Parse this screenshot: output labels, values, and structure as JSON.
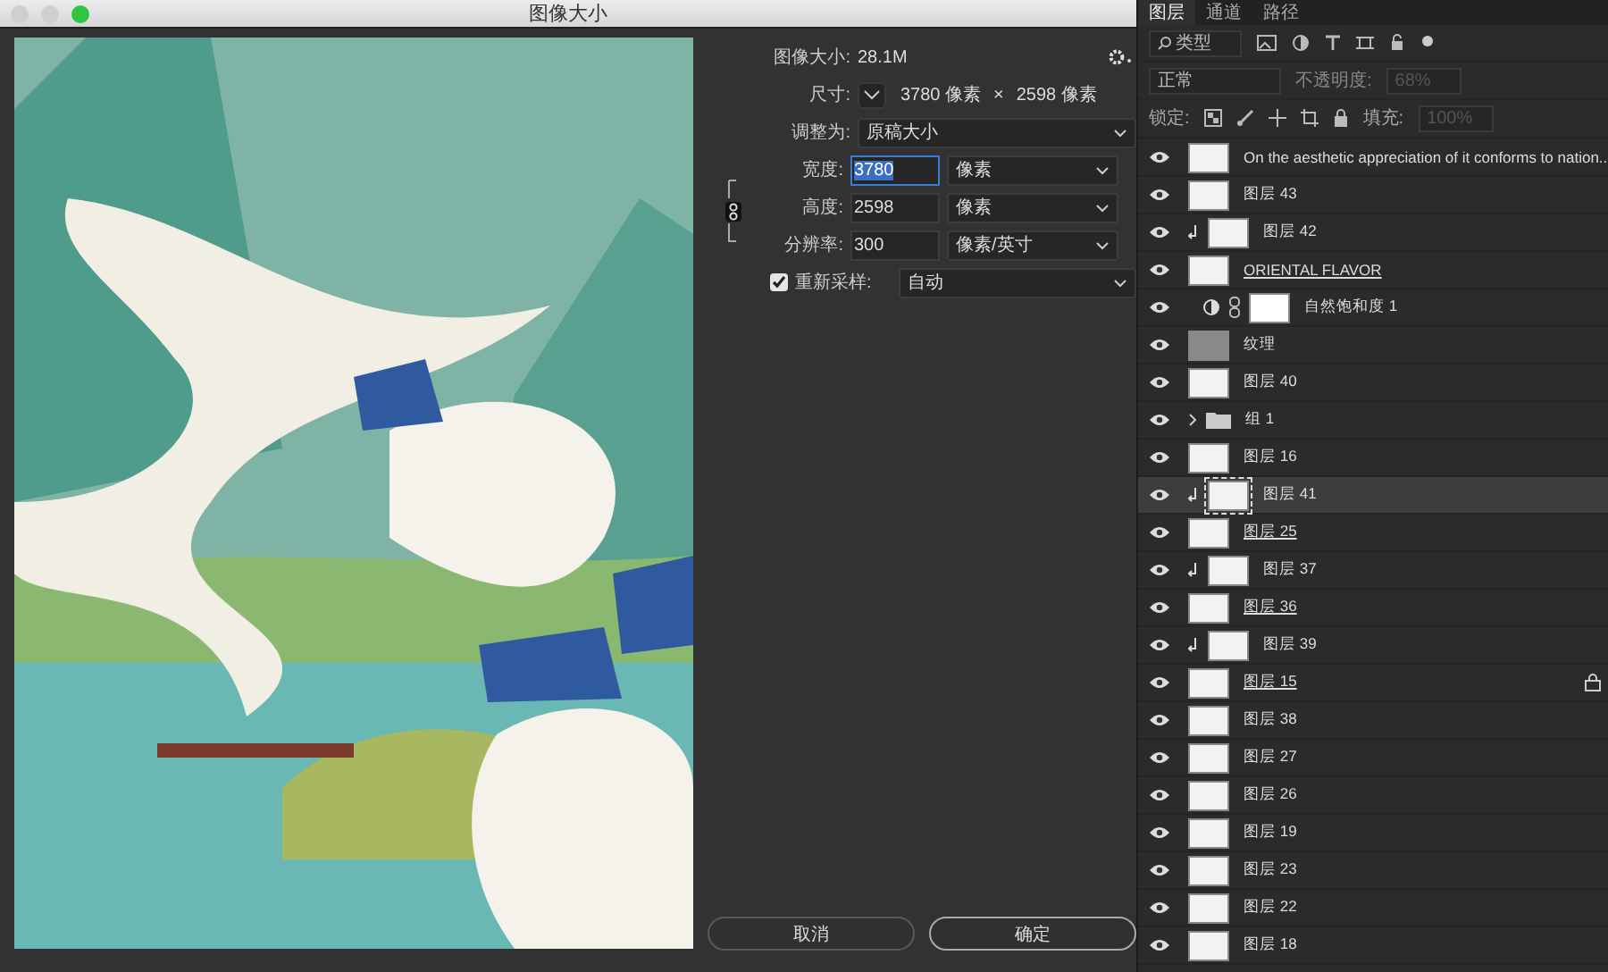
{
  "window": {
    "title": "图像大小"
  },
  "dialog": {
    "image_size": {
      "label": "图像大小:",
      "value": "28.1M"
    },
    "dimensions": {
      "label": "尺寸:",
      "width": "3780 像素",
      "times": "×",
      "height": "2598 像素"
    },
    "fit_to": {
      "label": "调整为:",
      "value": "原稿大小"
    },
    "fields": [
      {
        "label": "宽度:",
        "value": "3780",
        "unit": "像素",
        "selected": true
      },
      {
        "label": "高度:",
        "value": "2598",
        "unit": "像素",
        "selected": false
      },
      {
        "label": "分辨率:",
        "value": "300",
        "unit": "像素/英寸",
        "selected": false
      }
    ],
    "resample": {
      "label": "重新采样:",
      "checked": true,
      "value": "自动"
    },
    "buttons": [
      {
        "label": "取消",
        "primary": false
      },
      {
        "label": "确定",
        "primary": true
      }
    ]
  },
  "layers_panel": {
    "tabs": [
      {
        "label": "图层",
        "selected": true
      },
      {
        "label": "通道",
        "selected": false
      },
      {
        "label": "路径",
        "selected": false
      }
    ],
    "filter": {
      "value": "类型"
    },
    "blend_mode": "正常",
    "opacity": {
      "label": "不透明度:",
      "value": "68%",
      "disabled": true
    },
    "lock_label": "锁定:",
    "fill": {
      "label": "填充:",
      "value": "100%",
      "disabled": true
    },
    "layers": [
      {
        "name": "On the aesthetic appreciation of it conforms to nation...",
        "kind": "layer",
        "clipped": false,
        "underlined": false,
        "locked": false,
        "selected": false
      },
      {
        "name": "图层 43",
        "kind": "layer",
        "clipped": false,
        "underlined": false,
        "locked": false,
        "selected": false
      },
      {
        "name": "图层 42",
        "kind": "layer",
        "clipped": true,
        "underlined": false,
        "locked": false,
        "selected": false
      },
      {
        "name": "ORIENTAL FLAVOR",
        "kind": "layer",
        "clipped": false,
        "underlined": true,
        "locked": false,
        "selected": false
      },
      {
        "name": "自然饱和度 1",
        "kind": "adjustment",
        "clipped": false,
        "underlined": false,
        "locked": false,
        "selected": false
      },
      {
        "name": "纹理",
        "kind": "texture",
        "clipped": false,
        "underlined": false,
        "locked": false,
        "selected": false
      },
      {
        "name": "图层 40",
        "kind": "layer",
        "clipped": false,
        "underlined": false,
        "locked": false,
        "selected": false
      },
      {
        "name": "组 1",
        "kind": "group",
        "clipped": false,
        "underlined": false,
        "locked": false,
        "selected": false
      },
      {
        "name": "图层 16",
        "kind": "layer",
        "clipped": false,
        "underlined": false,
        "locked": false,
        "selected": false
      },
      {
        "name": "图层 41",
        "kind": "layer",
        "clipped": true,
        "underlined": false,
        "locked": false,
        "selected": true
      },
      {
        "name": "图层 25",
        "kind": "layer",
        "clipped": false,
        "underlined": true,
        "locked": false,
        "selected": false
      },
      {
        "name": "图层 37",
        "kind": "layer",
        "clipped": true,
        "underlined": false,
        "locked": false,
        "selected": false
      },
      {
        "name": "图层 36",
        "kind": "layer",
        "clipped": false,
        "underlined": true,
        "locked": false,
        "selected": false
      },
      {
        "name": "图层 39",
        "kind": "layer",
        "clipped": true,
        "underlined": false,
        "locked": false,
        "selected": false
      },
      {
        "name": "图层 15",
        "kind": "layer",
        "clipped": false,
        "underlined": true,
        "locked": true,
        "selected": false
      },
      {
        "name": "图层 38",
        "kind": "layer",
        "clipped": false,
        "underlined": false,
        "locked": false,
        "selected": false
      },
      {
        "name": "图层 27",
        "kind": "layer",
        "clipped": false,
        "underlined": false,
        "locked": false,
        "selected": false
      },
      {
        "name": "图层 26",
        "kind": "layer",
        "clipped": false,
        "underlined": false,
        "locked": false,
        "selected": false
      },
      {
        "name": "图层 19",
        "kind": "layer",
        "clipped": false,
        "underlined": false,
        "locked": false,
        "selected": false
      },
      {
        "name": "图层 23",
        "kind": "layer",
        "clipped": false,
        "underlined": false,
        "locked": false,
        "selected": false
      },
      {
        "name": "图层 22",
        "kind": "layer",
        "clipped": false,
        "underlined": false,
        "locked": false,
        "selected": false
      },
      {
        "name": "图层 18",
        "kind": "layer",
        "clipped": false,
        "underlined": false,
        "locked": false,
        "selected": false
      }
    ]
  }
}
